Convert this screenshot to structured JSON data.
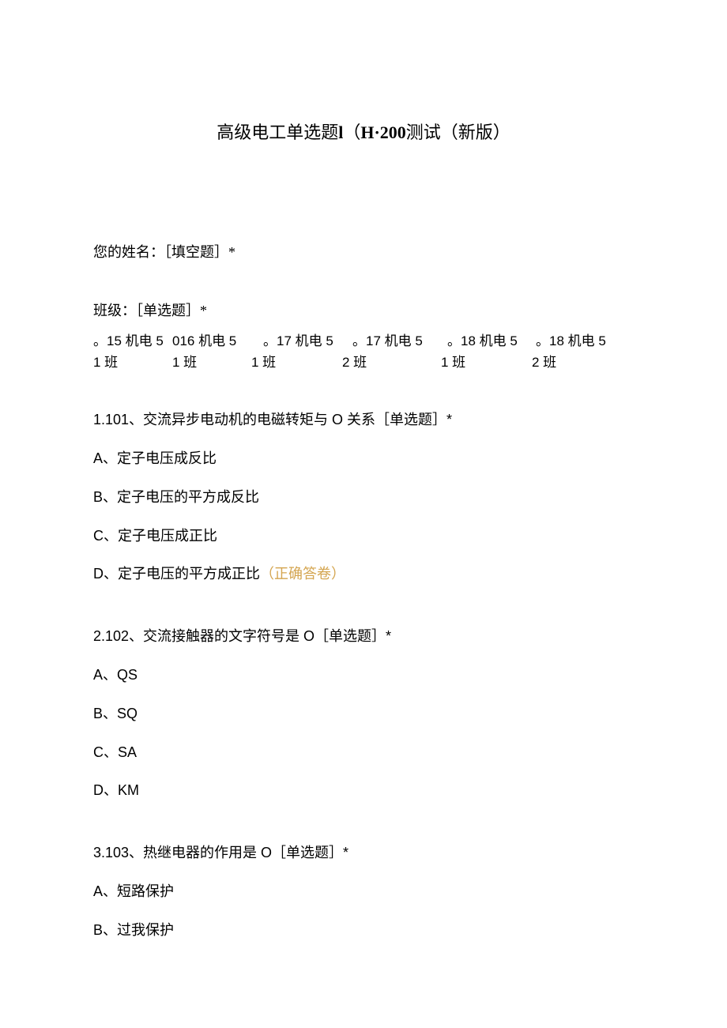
{
  "title": {
    "part1": "高级电工单选题",
    "part2": "l",
    "part3": "（",
    "part4": "H·200",
    "part5": "测试（新版）"
  },
  "name_label": "您的姓名：［填空题］*",
  "class_label": "班级：［单选题］*",
  "class_options": {
    "r1c1": "。15 机电 5",
    "r1c2": "016 机电 5  ",
    "r1c3": "。17 机电 5 ",
    "r1c4": "。17 机电 5  ",
    "r1c5": "。18 机电 5 ",
    "r1c6": "。18 机电 5",
    "r2c1": "1 班",
    "r2c2": "1 班",
    "r2c3": "1 班",
    "r2c4": "2 班",
    "r2c5": "1 班",
    "r2c6": "2 班"
  },
  "q1": {
    "title": "1.101、交流异步电动机的电磁转矩与 O 关系［单选题］*",
    "a": "A、定子电压成反比",
    "b": "B、定子电压的平方成反比",
    "c": "C、定子电压成正比",
    "d": "D、定子电压的平方成正比",
    "correct": "（正确答卷）"
  },
  "q2": {
    "title": "2.102、交流接触器的文字符号是 O［单选题］*",
    "a": "A、QS",
    "b": "B、SQ",
    "c": "C、SA",
    "d": "D、KM"
  },
  "q3": {
    "title": "3.103、热继电器的作用是 O［单选题］*",
    "a": "A、短路保护",
    "b": "B、过我保护"
  }
}
